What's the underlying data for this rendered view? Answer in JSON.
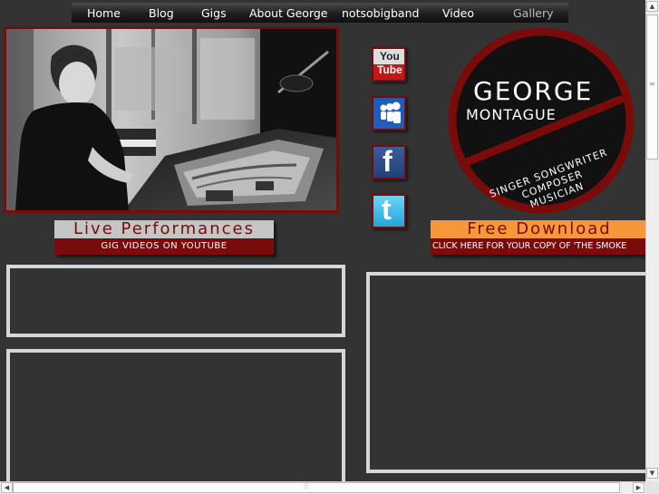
{
  "nav": {
    "items": [
      "Home",
      "Blog",
      "Gigs",
      "About George",
      "notsobigband",
      "Video",
      "Gallery"
    ]
  },
  "live": {
    "title": "Live Performances",
    "subtitle": "Gig videos on YouTube"
  },
  "free": {
    "title": "Free Download",
    "subtitle": "Click here for your copy of 'The Smoke"
  },
  "social": {
    "youtube_line1": "You",
    "youtube_line2": "Tube",
    "facebook_glyph": "f",
    "twitter_glyph": "t",
    "icons": [
      "youtube-icon",
      "myspace-icon",
      "facebook-icon",
      "twitter-icon"
    ]
  },
  "logo": {
    "name_first": "George",
    "name_last": "Montague",
    "role1": "Singer Songwriter",
    "role2": "Composer",
    "role3": "Musician"
  },
  "colors": {
    "background": "#333333",
    "accent_red": "#7a0b0b",
    "accent_orange": "#f6983a",
    "banner_grey": "#c5c5c5",
    "box_border": "#d6d6d6"
  }
}
